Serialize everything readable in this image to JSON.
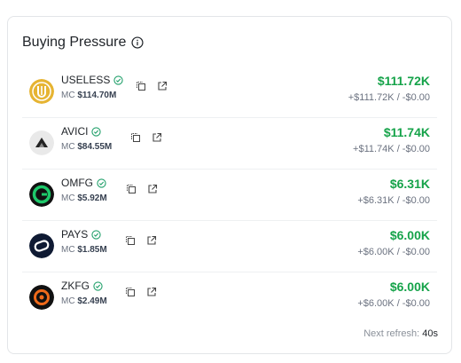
{
  "panel": {
    "title": "Buying Pressure",
    "footer_label": "Next refresh:",
    "footer_value": "40s"
  },
  "tokens": [
    {
      "symbol": "USELESS",
      "mc_label": "MC",
      "mc": "$114.70M",
      "amount": "$111.72K",
      "detail": "+$111.72K / -$0.00",
      "logo": "useless-logo",
      "accent": "#e6b432"
    },
    {
      "symbol": "AVICI",
      "mc_label": "MC",
      "mc": "$84.55M",
      "amount": "$11.74K",
      "detail": "+$11.74K / -$0.00",
      "logo": "avici-logo",
      "accent": "#e9e9e9"
    },
    {
      "symbol": "OMFG",
      "mc_label": "MC",
      "mc": "$5.92M",
      "amount": "$6.31K",
      "detail": "+$6.31K / -$0.00",
      "logo": "omfg-logo",
      "accent": "#1ec96b"
    },
    {
      "symbol": "PAYS",
      "mc_label": "MC",
      "mc": "$1.85M",
      "amount": "$6.00K",
      "detail": "+$6.00K / -$0.00",
      "logo": "pays-logo",
      "accent": "#0f1a33"
    },
    {
      "symbol": "ZKFG",
      "mc_label": "MC",
      "mc": "$2.49M",
      "amount": "$6.00K",
      "detail": "+$6.00K / -$0.00",
      "logo": "zkfg-logo",
      "accent": "#f06a1a"
    }
  ],
  "icons": {
    "info": "info-icon",
    "verified": "verified-check-icon",
    "copy": "copy-icon",
    "external": "external-link-icon"
  },
  "colors": {
    "positive": "#16a34a",
    "verified": "#22a06b",
    "muted": "#6b7280"
  }
}
